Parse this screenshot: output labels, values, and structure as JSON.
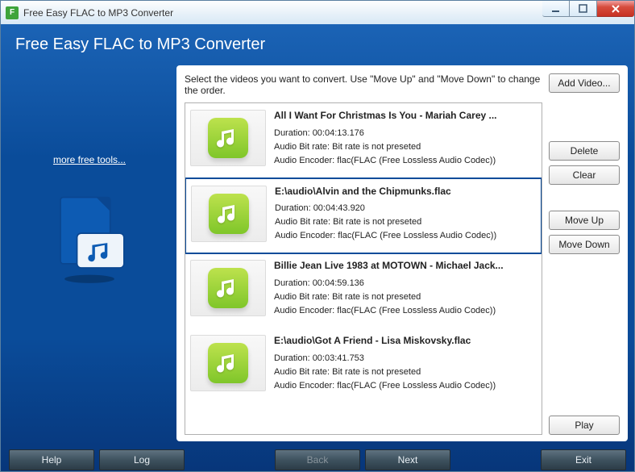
{
  "window": {
    "title": "Free Easy FLAC to MP3 Converter"
  },
  "header": {
    "title": "Free Easy FLAC to MP3 Converter"
  },
  "sidebar": {
    "more_tools_label": "more free tools..."
  },
  "main": {
    "instruction": "Select the videos you want to convert. Use \"Move Up\" and \"Move Down\" to change the order.",
    "files": [
      {
        "name": "All I Want For Christmas Is You - Mariah Carey ...",
        "duration": "Duration: 00:04:13.176",
        "bitrate": "Audio Bit rate: Bit rate is not preseted",
        "encoder": "Audio Encoder: flac(FLAC (Free Lossless Audio Codec))",
        "selected": false
      },
      {
        "name": "E:\\audio\\Alvin and the Chipmunks.flac",
        "duration": "Duration: 00:04:43.920",
        "bitrate": "Audio Bit rate: Bit rate is not preseted",
        "encoder": "Audio Encoder: flac(FLAC (Free Lossless Audio Codec))",
        "selected": true
      },
      {
        "name": "Billie Jean Live 1983 at MOTOWN - Michael Jack...",
        "duration": "Duration: 00:04:59.136",
        "bitrate": "Audio Bit rate: Bit rate is not preseted",
        "encoder": "Audio Encoder: flac(FLAC (Free Lossless Audio Codec))",
        "selected": false
      },
      {
        "name": "E:\\audio\\Got A Friend - Lisa Miskovsky.flac",
        "duration": "Duration: 00:03:41.753",
        "bitrate": "Audio Bit rate: Bit rate is not preseted",
        "encoder": "Audio Encoder: flac(FLAC (Free Lossless Audio Codec))",
        "selected": false
      }
    ]
  },
  "buttons": {
    "add_video": "Add Video...",
    "delete": "Delete",
    "clear": "Clear",
    "move_up": "Move Up",
    "move_down": "Move Down",
    "play": "Play"
  },
  "footer": {
    "help": "Help",
    "log": "Log",
    "back": "Back",
    "next": "Next",
    "exit": "Exit"
  }
}
